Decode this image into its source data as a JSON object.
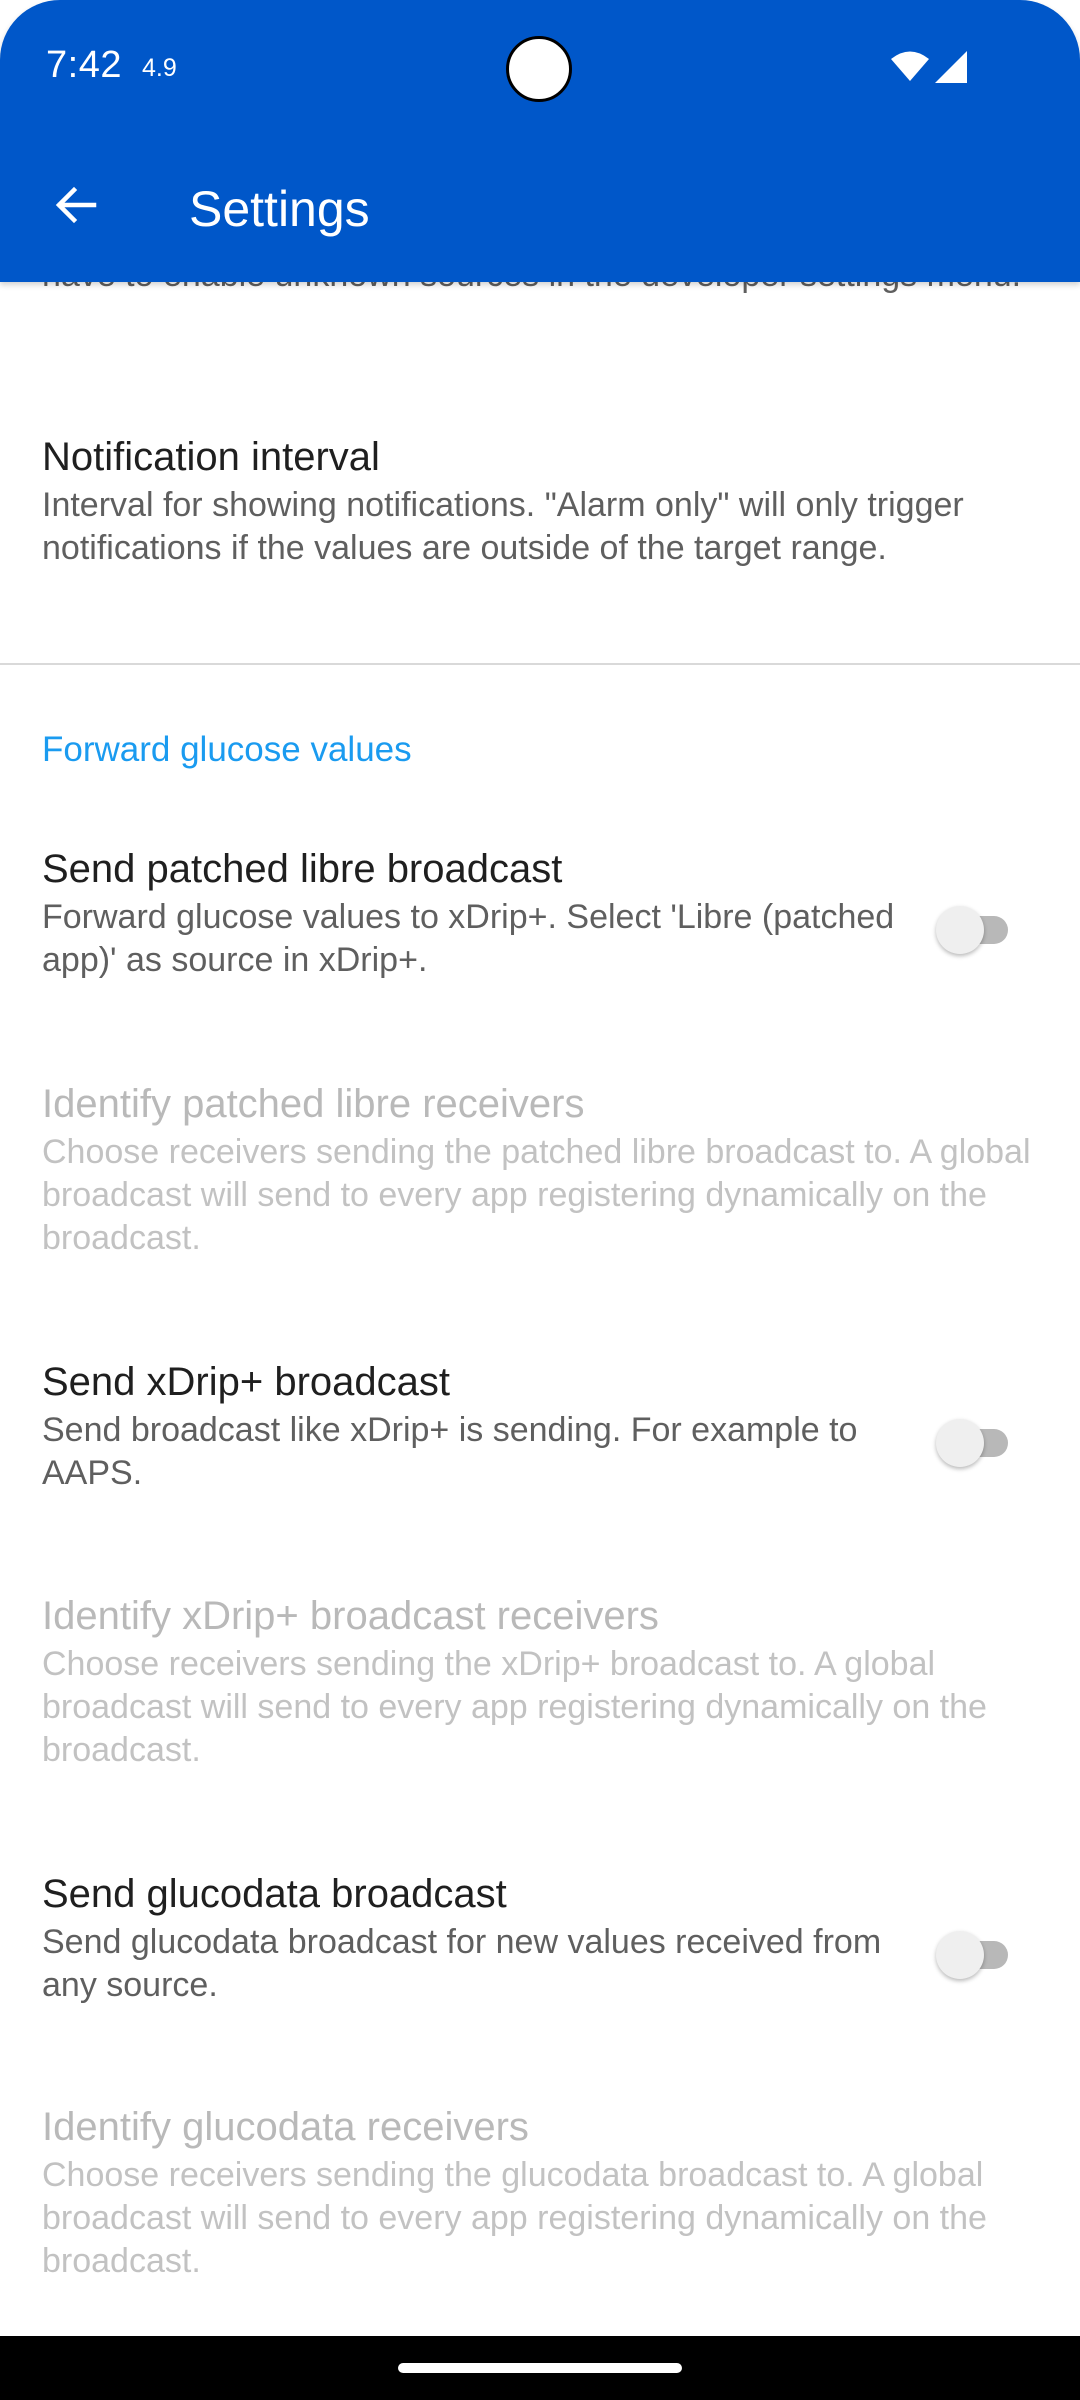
{
  "status_bar": {
    "time": "7:42",
    "extra": "4.9"
  },
  "app_bar": {
    "title": "Settings"
  },
  "prefs": {
    "partial_top": {
      "summary": "have to enable unknown sources in the developer settings menu."
    },
    "notification_interval": {
      "title": "Notification interval",
      "summary": "Interval for showing notifications. \"Alarm only\" will only trigger notifications if the values are outside of the target range."
    },
    "section_forward": {
      "title": "Forward glucose values"
    },
    "send_patched_libre": {
      "title": "Send patched libre broadcast",
      "summary": "Forward glucose values to xDrip+. Select 'Libre (patched app)' as source in xDrip+.",
      "enabled": false
    },
    "identify_patched_libre": {
      "title": "Identify patched libre receivers",
      "summary": "Choose receivers sending the patched libre broadcast to. A global broadcast will send to every app registering dynamically on the broadcast."
    },
    "send_xdrip": {
      "title": "Send xDrip+ broadcast",
      "summary": "Send broadcast like xDrip+ is sending. For example to AAPS.",
      "enabled": false
    },
    "identify_xdrip": {
      "title": "Identify xDrip+ broadcast receivers",
      "summary": "Choose receivers sending the xDrip+ broadcast to. A global broadcast will send to every app registering dynamically on the broadcast."
    },
    "send_glucodata": {
      "title": "Send glucodata broadcast",
      "summary": "Send glucodata broadcast for new values received from any source.",
      "enabled": false
    },
    "identify_glucodata": {
      "title": "Identify glucodata receivers",
      "summary": "Choose receivers sending the glucodata broadcast to. A global broadcast will send to every app registering dynamically on the broadcast."
    }
  },
  "colors": {
    "app_bar": "#0057c9",
    "accent": "#1a9bf0"
  }
}
